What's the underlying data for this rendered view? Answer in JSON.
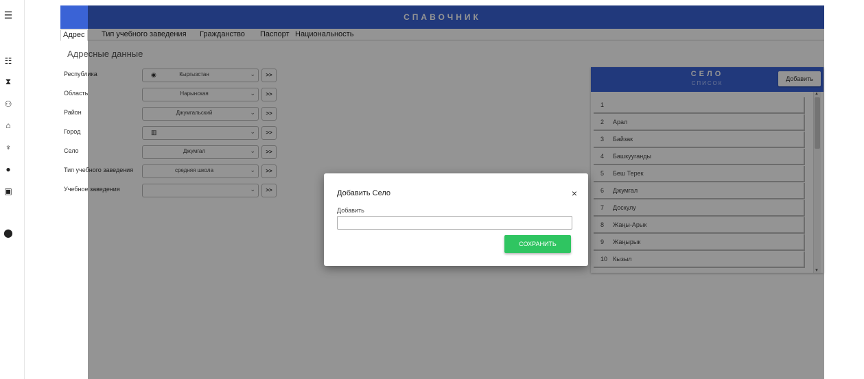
{
  "sidebar": {
    "icons": [
      "menu-icon",
      "list-icon",
      "hourglass-icon",
      "people-icon",
      "bank-icon",
      "cup-icon",
      "alert-icon",
      "id-card-icon",
      "location-pin-icon"
    ]
  },
  "header": {
    "title": "СПАВОЧНИК"
  },
  "tabs": [
    {
      "label": "Адрес"
    },
    {
      "label": "Тип учебного заведения"
    },
    {
      "label": "Гражданство"
    },
    {
      "label": "Паспорт"
    },
    {
      "label": "Национальность"
    }
  ],
  "section_title": "Адресные данные",
  "fields": [
    {
      "label": "Республика",
      "value": "Кыргызстан",
      "btn": ">>"
    },
    {
      "label": "Область",
      "value": "Нарынская",
      "btn": ">>"
    },
    {
      "label": "Район",
      "value": "Джумгальский",
      "btn": ">>"
    },
    {
      "label": "Город",
      "value": "",
      "btn": ">>"
    },
    {
      "label": "Село",
      "value": "Джумгал",
      "btn": ">>"
    },
    {
      "label": "Тип учебного заведения",
      "value": "средняя школа",
      "btn": ">>"
    },
    {
      "label": "Учебное заведения",
      "value": "",
      "btn": ">>"
    }
  ],
  "panel": {
    "title": "СЕЛО",
    "subtitle": "СПИСОК",
    "add_label": "Добавить",
    "items": [
      {
        "num": "1",
        "name": ""
      },
      {
        "num": "2",
        "name": "Арал"
      },
      {
        "num": "3",
        "name": "Байзак"
      },
      {
        "num": "4",
        "name": "Башкууганды"
      },
      {
        "num": "5",
        "name": "Беш Терек"
      },
      {
        "num": "6",
        "name": "Джумгал"
      },
      {
        "num": "7",
        "name": "Доскулу"
      },
      {
        "num": "8",
        "name": "Жаңы-Арык"
      },
      {
        "num": "9",
        "name": "Жаңырык"
      },
      {
        "num": "10",
        "name": "Кызыл"
      }
    ]
  },
  "modal": {
    "title": "Добавить Село",
    "close": "×",
    "label": "Добавить",
    "input_value": "",
    "save_label": "СОХРАНИТЬ"
  },
  "colors": {
    "header": "#3a63d6",
    "save": "#2fc561"
  }
}
